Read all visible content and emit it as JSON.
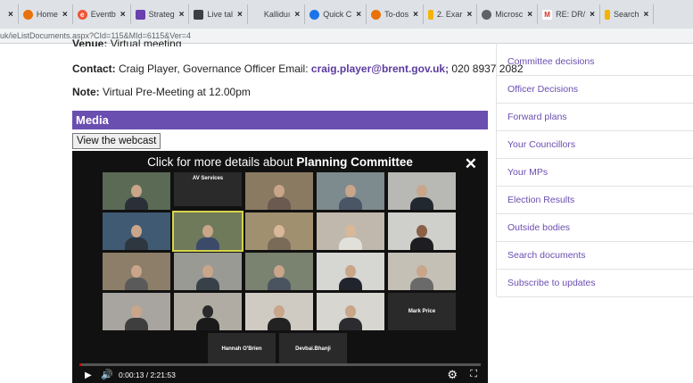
{
  "browser": {
    "tabs": [
      {
        "title": "",
        "icon": "",
        "color": "#dee1e6"
      },
      {
        "title": "Home",
        "icon": "chrome-icon",
        "color": "#e8710a"
      },
      {
        "title": "Eventb",
        "icon": "eventbrite-icon",
        "color": "#f05537"
      },
      {
        "title": "Strateg",
        "icon": "doc-icon",
        "color": "#6a3fb0"
      },
      {
        "title": "Live tal",
        "icon": "live-icon",
        "color": "#3c4043"
      },
      {
        "title": "Kalliduı",
        "icon": "",
        "color": "#dee1e6"
      },
      {
        "title": "Quick C",
        "icon": "quick-icon",
        "color": "#1a73e8"
      },
      {
        "title": "To-dos",
        "icon": "todo-icon",
        "color": "#e8710a"
      },
      {
        "title": "2. Exar",
        "icon": "file-icon",
        "color": "#f4b400"
      },
      {
        "title": "Microsc",
        "icon": "microsoft-icon",
        "color": "#5f6368"
      },
      {
        "title": "RE: DR/",
        "icon": "gmail-icon",
        "color": "#d93025"
      },
      {
        "title": "Search",
        "icon": "search-icon",
        "color": "#f4b400"
      }
    ],
    "address": "uk/ieListDocuments.aspx?CId=115&MId=6115&Ver=4"
  },
  "meeting": {
    "venue_label": "Venue:",
    "venue_value": "Virtual meeting",
    "contact_label": "Contact:",
    "contact_text": "Craig Player, Governance Officer  Email: ",
    "contact_email": "craig.player@brent.gov.uk;",
    "contact_phone": " 020 8937 2082",
    "note_label": "Note:",
    "note_text": "Virtual Pre-Meeting at 12.00pm"
  },
  "media": {
    "heading": "Media",
    "webcast_button": "View the webcast"
  },
  "player": {
    "title_prefix": "Click for more details about ",
    "title_bold": "Planning Committee",
    "tile_labels": {
      "av": "AV Services",
      "mark": "Mark Price",
      "hannah": "Hannah O'Brien",
      "devbai": "Devbai.Bhanji"
    },
    "time": "0:00:13 / 2:21:53",
    "progress_fraction": 0.0015
  },
  "sidebar": {
    "items": [
      "Committee decisions",
      "Officer Decisions",
      "Forward plans",
      "Your Councillors",
      "Your MPs",
      "Election Results",
      "Outside bodies",
      "Search documents",
      "Subscribe to updates"
    ]
  }
}
